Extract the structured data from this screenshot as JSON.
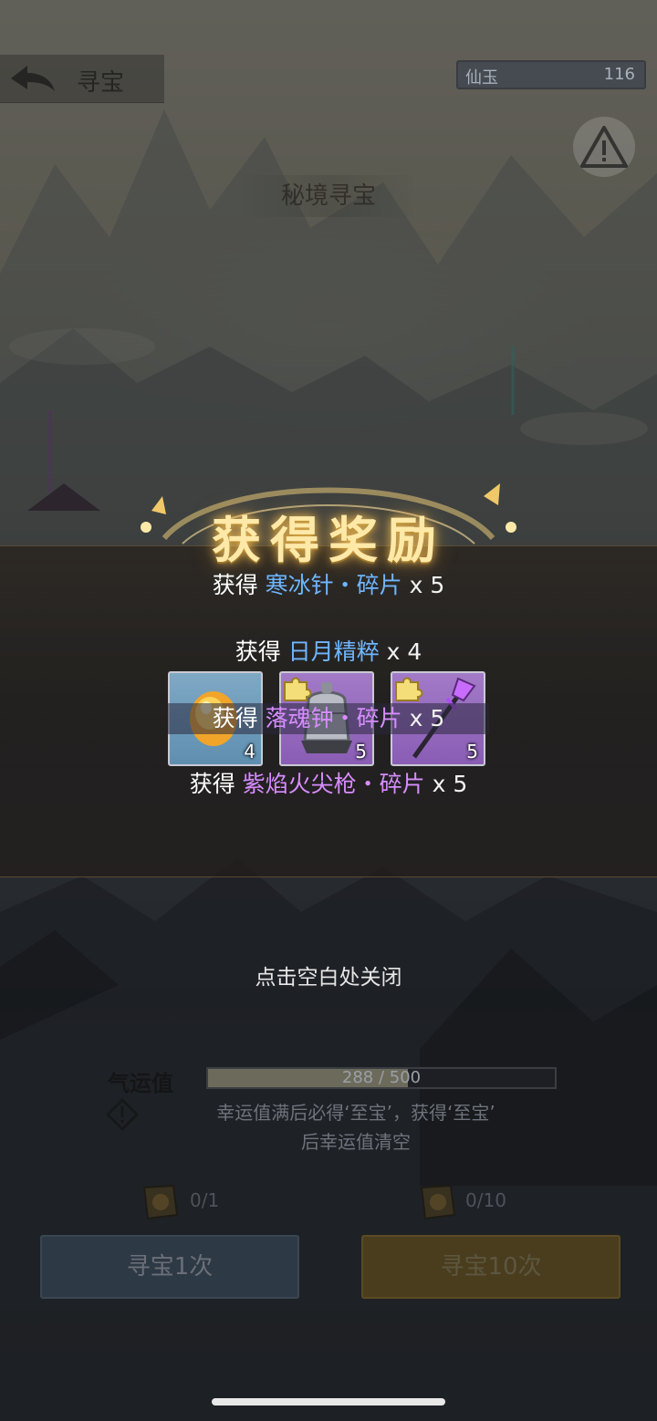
{
  "header": {
    "back_label": "寻宝",
    "currency_name": "仙玉",
    "currency_value": "116",
    "page_title": "秘境寻宝"
  },
  "reward_popup": {
    "banner_title": "获得奖励",
    "prefix": "获得",
    "lines": [
      {
        "item": "寒冰针・碎片",
        "qty": "x 5",
        "color": "#6fb6ff"
      },
      {
        "item": "日月精粹",
        "qty": "x 4",
        "color": "#6fb6ff"
      },
      {
        "item": "落魂钟・碎片",
        "qty": "x 5",
        "color": "#d78cff"
      },
      {
        "item": "紫焰火尖枪・碎片",
        "qty": "x 5",
        "color": "#d78cff"
      }
    ],
    "slots": [
      {
        "name": "日月精粹",
        "count": "4",
        "rarity": "blue"
      },
      {
        "name": "落魂钟・碎片",
        "count": "5",
        "rarity": "purple"
      },
      {
        "name": "紫焰火尖枪・碎片",
        "count": "5",
        "rarity": "purple"
      }
    ],
    "close_hint": "点击空白处关闭"
  },
  "luck": {
    "label": "气运值",
    "current": 288,
    "max": 500,
    "text": "288 / 500",
    "info_line1": "幸运值满后必得‘至宝’，获得‘至宝’",
    "info_line2": "后幸运值清空"
  },
  "draw": {
    "single": {
      "ticket": "0/1",
      "label": "寻宝1次"
    },
    "ten": {
      "ticket": "0/10",
      "label": "寻宝10次"
    }
  }
}
